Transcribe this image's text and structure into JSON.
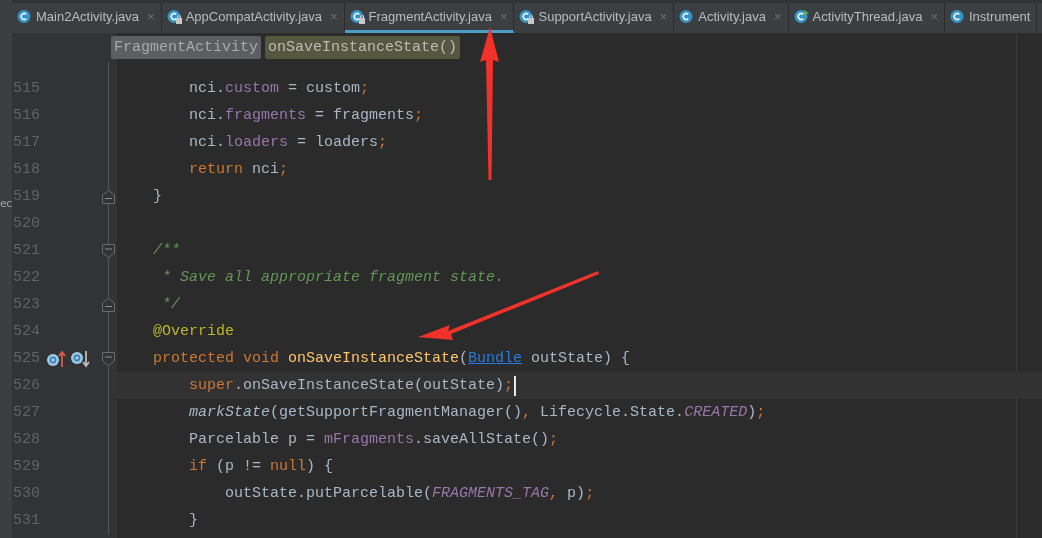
{
  "side_panel_fragment": "ec",
  "tabs": [
    {
      "label": "Main2Activity.java",
      "kind": "class",
      "close": "×",
      "selected": false
    },
    {
      "label": "AppCompatActivity.java",
      "kind": "class-locked",
      "close": "×",
      "selected": false
    },
    {
      "label": "FragmentActivity.java",
      "kind": "class-locked",
      "close": "×",
      "selected": true
    },
    {
      "label": "SupportActivity.java",
      "kind": "class-locked",
      "close": "×",
      "selected": false
    },
    {
      "label": "Activity.java",
      "kind": "class",
      "close": "×",
      "selected": false
    },
    {
      "label": "ActivityThread.java",
      "kind": "class-run",
      "close": "×",
      "selected": false
    },
    {
      "label": "Instrument",
      "kind": "class",
      "selected": false
    }
  ],
  "breadcrumbs": [
    {
      "label": "FragmentActivity",
      "selected": false
    },
    {
      "label": "onSaveInstanceState()",
      "selected": true
    }
  ],
  "lines": [
    {
      "number": "515",
      "current": false,
      "tokens": [
        {
          "text": "        nci.",
          "kind": "plain"
        },
        {
          "text": "custom",
          "kind": "field"
        },
        {
          "text": " = custom",
          "kind": "plain"
        },
        {
          "text": ";",
          "kind": "punct"
        }
      ]
    },
    {
      "number": "516",
      "current": false,
      "tokens": [
        {
          "text": "        nci.",
          "kind": "plain"
        },
        {
          "text": "fragments",
          "kind": "field"
        },
        {
          "text": " = fragments",
          "kind": "plain"
        },
        {
          "text": ";",
          "kind": "punct"
        }
      ]
    },
    {
      "number": "517",
      "current": false,
      "tokens": [
        {
          "text": "        nci.",
          "kind": "plain"
        },
        {
          "text": "loaders",
          "kind": "field"
        },
        {
          "text": " = loaders",
          "kind": "plain"
        },
        {
          "text": ";",
          "kind": "punct"
        }
      ]
    },
    {
      "number": "518",
      "current": false,
      "tokens": [
        {
          "text": "        return",
          "kind": "keyword"
        },
        {
          "text": " nci",
          "kind": "plain"
        },
        {
          "text": ";",
          "kind": "punct"
        }
      ]
    },
    {
      "number": "519",
      "current": false,
      "kind": "fold-end",
      "tokens": [
        {
          "text": "    }",
          "kind": "plain"
        }
      ]
    },
    {
      "number": "520",
      "current": false
    },
    {
      "number": "521",
      "current": false,
      "kind": "fold-start",
      "tokens": [
        {
          "text": "    /**",
          "kind": "comment"
        }
      ]
    },
    {
      "number": "522",
      "current": false,
      "tokens": [
        {
          "text": "     * Save all appropriate fragment state.",
          "kind": "comment"
        }
      ]
    },
    {
      "number": "523",
      "current": false,
      "kind": "fold-end",
      "tokens": [
        {
          "text": "     */",
          "kind": "comment"
        }
      ]
    },
    {
      "number": "524",
      "current": false,
      "tokens": [
        {
          "text": "    @Override",
          "kind": "annotation"
        }
      ]
    },
    {
      "number": "525",
      "current": false,
      "kind": "override-fold-start",
      "tokens": [
        {
          "text": "    protected void ",
          "kind": "keyword"
        },
        {
          "text": "onSaveInstanceState",
          "kind": "decl"
        },
        {
          "text": "(",
          "kind": "plain"
        },
        {
          "text": "Bundle",
          "kind": "link"
        },
        {
          "text": " outState) {",
          "kind": "plain"
        }
      ]
    },
    {
      "number": "526",
      "current": true,
      "tokens": [
        {
          "text": "        super",
          "kind": "keyword"
        },
        {
          "text": ".onSaveInstanceState(outState)",
          "kind": "plain"
        },
        {
          "text": ";",
          "kind": "punct"
        }
      ]
    },
    {
      "number": "527",
      "current": false,
      "tokens": [
        {
          "text": "        markState",
          "kind": "call"
        },
        {
          "text": "(getSupportFragmentManager()",
          "kind": "plain"
        },
        {
          "text": ",",
          "kind": "punct"
        },
        {
          "text": " Lifecycle.State.",
          "kind": "plain"
        },
        {
          "text": "CREATED",
          "kind": "constant"
        },
        {
          "text": ")",
          "kind": "plain"
        },
        {
          "text": ";",
          "kind": "punct"
        }
      ]
    },
    {
      "number": "528",
      "current": false,
      "tokens": [
        {
          "text": "        Parcelable p = ",
          "kind": "plain"
        },
        {
          "text": "mFragments",
          "kind": "field"
        },
        {
          "text": ".saveAllState()",
          "kind": "plain"
        },
        {
          "text": ";",
          "kind": "punct"
        }
      ]
    },
    {
      "number": "529",
      "current": false,
      "tokens": [
        {
          "text": "        if",
          "kind": "keyword"
        },
        {
          "text": " (p != ",
          "kind": "plain"
        },
        {
          "text": "null",
          "kind": "keyword"
        },
        {
          "text": ") {",
          "kind": "plain"
        }
      ]
    },
    {
      "number": "530",
      "current": false,
      "tokens": [
        {
          "text": "            outState.putParcelable(",
          "kind": "plain"
        },
        {
          "text": "FRAGMENTS_TAG",
          "kind": "constant"
        },
        {
          "text": ",",
          "kind": "punct"
        },
        {
          "text": " p)",
          "kind": "plain"
        },
        {
          "text": ";",
          "kind": "punct"
        }
      ]
    },
    {
      "number": "531",
      "current": false,
      "tokens": [
        {
          "text": "        }",
          "kind": "plain"
        }
      ]
    }
  ],
  "annotations": [
    {
      "kind": "arrow"
    },
    {
      "kind": "arrow"
    }
  ]
}
